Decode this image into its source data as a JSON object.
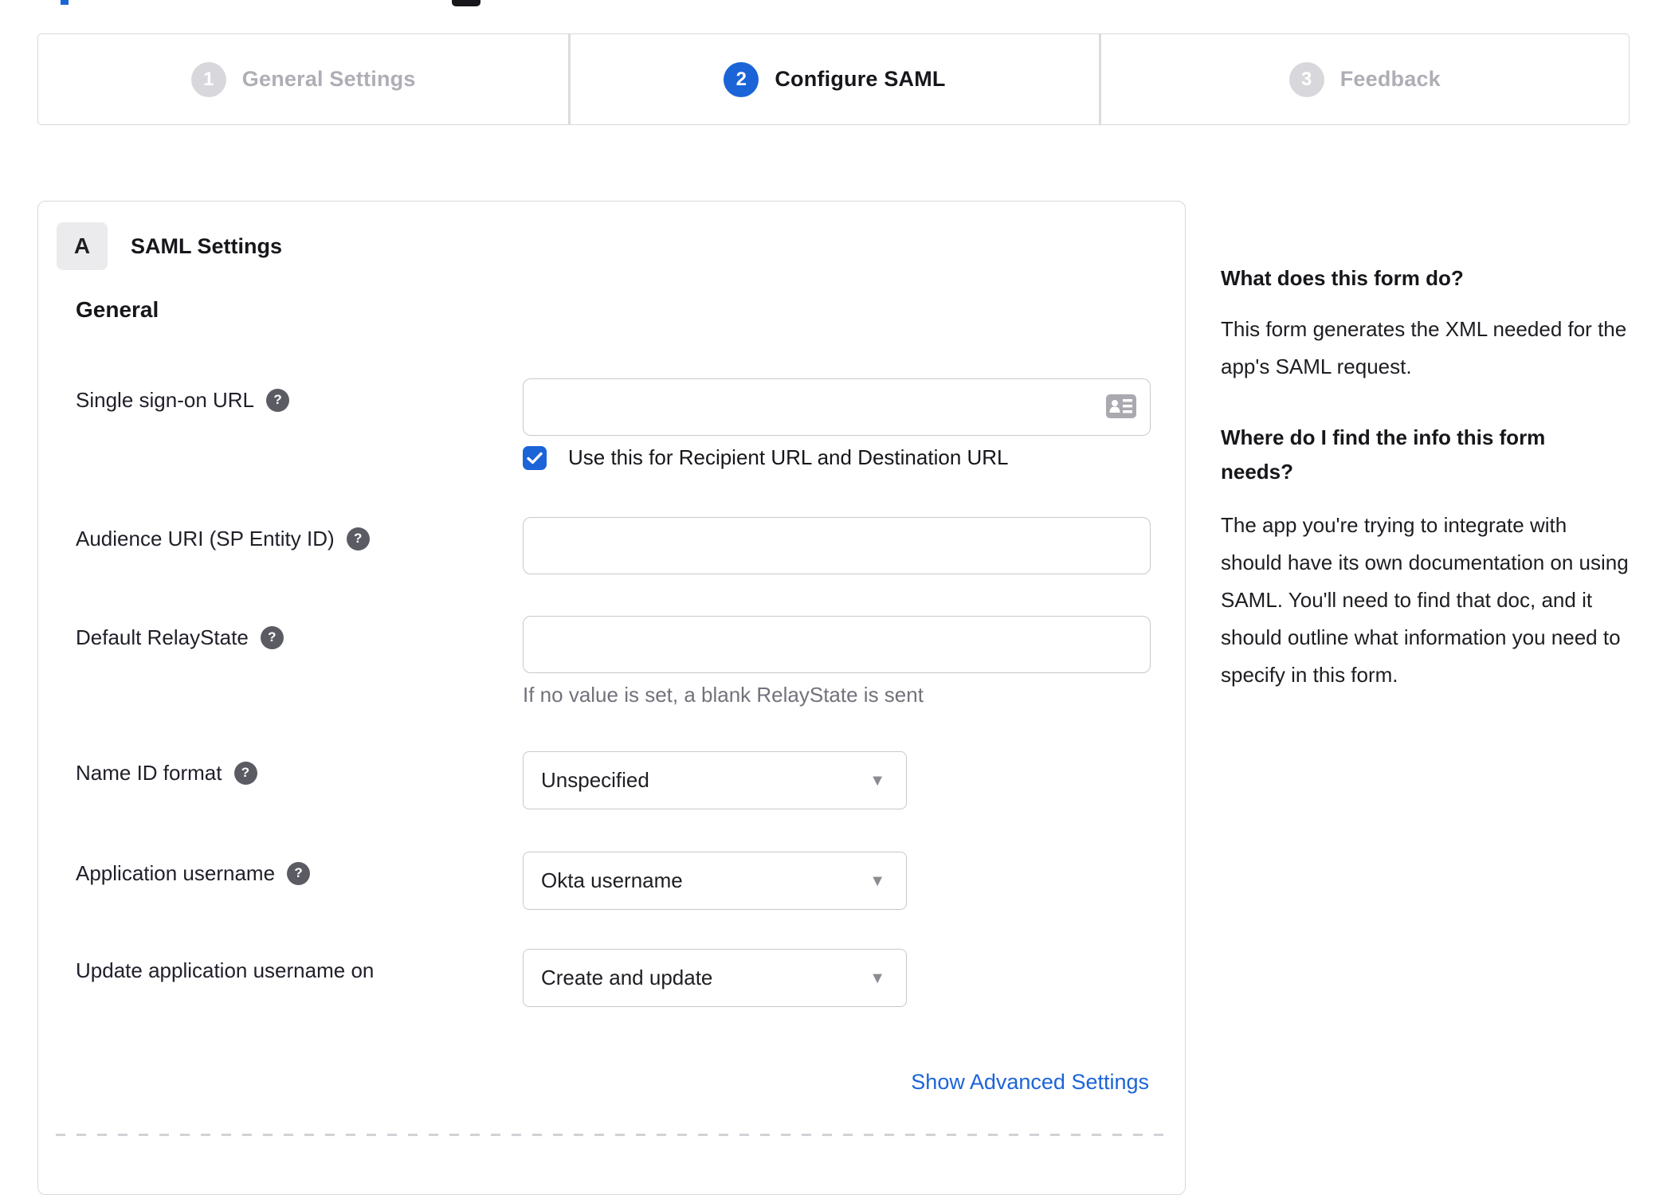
{
  "colors": {
    "accent_blue": "#1b64d8",
    "border_gray": "#d8d8dc",
    "text_dark": "#16161b",
    "muted_gray": "#72727c",
    "inactive_step_circle": "#d8d8dc",
    "inactive_step_label": "#aeaeb6",
    "help_icon_bg": "#5b5b63"
  },
  "icons": {
    "help_glyph": "?",
    "caret_glyph": "▼"
  },
  "stepper": {
    "steps": [
      {
        "number": "1",
        "label": "General Settings",
        "state": "inactive"
      },
      {
        "number": "2",
        "label": "Configure SAML",
        "state": "active"
      },
      {
        "number": "3",
        "label": "Feedback",
        "state": "inactive"
      }
    ]
  },
  "panel": {
    "section_letter": "A",
    "section_title": "SAML Settings",
    "group_heading": "General",
    "fields": {
      "sso_url": {
        "label": "Single sign-on URL",
        "value": "",
        "checkbox": {
          "checked": true,
          "label": "Use this for Recipient URL and Destination URL"
        }
      },
      "audience_uri": {
        "label": "Audience URI (SP Entity ID)",
        "value": ""
      },
      "default_relaystate": {
        "label": "Default RelayState",
        "value": "",
        "hint": "If no value is set, a blank RelayState is sent"
      },
      "name_id_format": {
        "label": "Name ID format",
        "value": "Unspecified"
      },
      "app_username": {
        "label": "Application username",
        "value": "Okta username"
      },
      "update_app_username": {
        "label": "Update application username on",
        "value": "Create and update"
      }
    },
    "advanced_link_label": "Show Advanced Settings"
  },
  "sidebar": {
    "sections": [
      {
        "heading": "What does this form do?",
        "body": "This form generates the XML needed for the app's SAML request."
      },
      {
        "heading": "Where do I find the info this form needs?",
        "body": "The app you're trying to integrate with should have its own documentation on using SAML. You'll need to find that doc, and it should outline what information you need to specify in this form."
      }
    ]
  }
}
